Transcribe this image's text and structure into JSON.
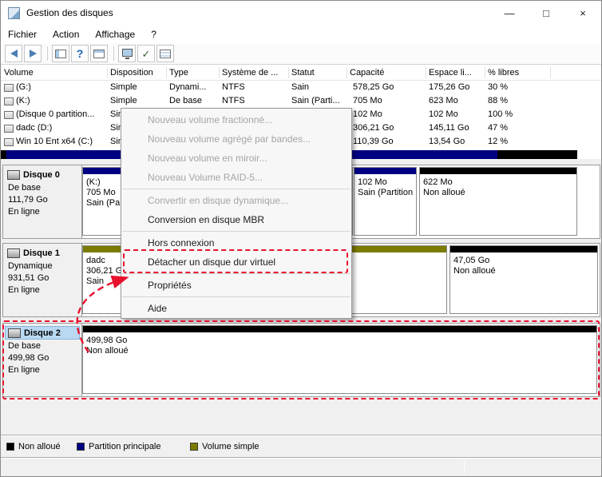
{
  "window": {
    "title": "Gestion des disques",
    "minimize_glyph": "—",
    "maximize_glyph": "□",
    "close_glyph": "×"
  },
  "menubar": {
    "items": [
      "Fichier",
      "Action",
      "Affichage",
      "?"
    ]
  },
  "toolbar": {
    "help_glyph": "?",
    "check_glyph": "✓"
  },
  "volume_table": {
    "columns": [
      "Volume",
      "Disposition",
      "Type",
      "Système de ...",
      "Statut",
      "Capacité",
      "Espace li...",
      "% libres"
    ],
    "rows": [
      {
        "volume": "(G:)",
        "disposition": "Simple",
        "type": "Dynami...",
        "systeme": "NTFS",
        "statut": "Sain",
        "capacite": "578,25 Go",
        "espace": "175,26 Go",
        "libres": "30 %"
      },
      {
        "volume": "(K:)",
        "disposition": "Simple",
        "type": "De base",
        "systeme": "NTFS",
        "statut": "Sain (Parti...",
        "capacite": "705 Mo",
        "espace": "623 Mo",
        "libres": "88 %"
      },
      {
        "volume": "(Disque 0 partition...",
        "disposition": "Simple",
        "type": "",
        "systeme": "",
        "statut": "",
        "capacite": "102 Mo",
        "espace": "102 Mo",
        "libres": "100 %"
      },
      {
        "volume": "dadc (D:)",
        "disposition": "Simple",
        "type": "",
        "systeme": "",
        "statut": "",
        "capacite": "306,21 Go",
        "espace": "145,11 Go",
        "libres": "47 %"
      },
      {
        "volume": "Win 10 Ent x64 (C:)",
        "disposition": "Simple",
        "type": "",
        "systeme": "",
        "statut": "",
        "capacite": "110,39 Go",
        "espace": "13,54 Go",
        "libres": "12 %"
      }
    ]
  },
  "context_menu": {
    "items": [
      {
        "label": "Nouveau volume fractionné...",
        "enabled": false
      },
      {
        "label": "Nouveau volume agrégé par bandes...",
        "enabled": false
      },
      {
        "label": "Nouveau volume en miroir...",
        "enabled": false
      },
      {
        "label": "Nouveau Volume RAID-5...",
        "enabled": false
      },
      {
        "label": "Convertir en disque dynamique...",
        "enabled": false
      },
      {
        "label": "Conversion en disque MBR",
        "enabled": true
      },
      {
        "label": "Hors connexion",
        "enabled": true
      },
      {
        "label": "Détacher un disque dur virtuel",
        "enabled": true
      },
      {
        "label": "Propriétés",
        "enabled": true
      },
      {
        "label": "Aide",
        "enabled": true
      }
    ]
  },
  "disks": [
    {
      "name": "Disque 0",
      "type": "De base",
      "size": "111,79 Go",
      "status": "En ligne",
      "partitions": [
        {
          "l1": "(K:)",
          "l2": "705 Mo",
          "l3": "Sain (Partition",
          "color": "#000082"
        },
        {
          "l1": "",
          "l2": "",
          "l3": "",
          "color": "#000082"
        },
        {
          "l1": "102 Mo",
          "l2": "Sain (Partition",
          "l3": "",
          "color": "#000082"
        },
        {
          "l1": "622 Mo",
          "l2": "Non alloué",
          "l3": "",
          "color": "#000000"
        }
      ]
    },
    {
      "name": "Disque 1",
      "type": "Dynamique",
      "size": "931,51 Go",
      "status": "En ligne",
      "partitions": [
        {
          "l1": "dadc",
          "l2": "306,21 Go",
          "l3": "Sain",
          "color": "#7b7b00"
        },
        {
          "l1": "",
          "l2": "",
          "l3": "",
          "color": "#7b7b00"
        },
        {
          "l1": "47,05 Go",
          "l2": "Non alloué",
          "l3": "",
          "color": "#000000"
        }
      ]
    },
    {
      "name": "Disque 2",
      "type": "De base",
      "size": "499,98 Go",
      "status": "En ligne",
      "partitions": [
        {
          "l1": "499,98 Go",
          "l2": "Non alloué",
          "l3": "",
          "color": "#000000"
        }
      ]
    }
  ],
  "legend": {
    "items": [
      {
        "label": "Non alloué",
        "color": "#000000"
      },
      {
        "label": "Partition principale",
        "color": "#000082"
      },
      {
        "label": "Volume simple",
        "color": "#7b7b00"
      }
    ]
  },
  "annotation": {
    "color": "#e8112d"
  }
}
